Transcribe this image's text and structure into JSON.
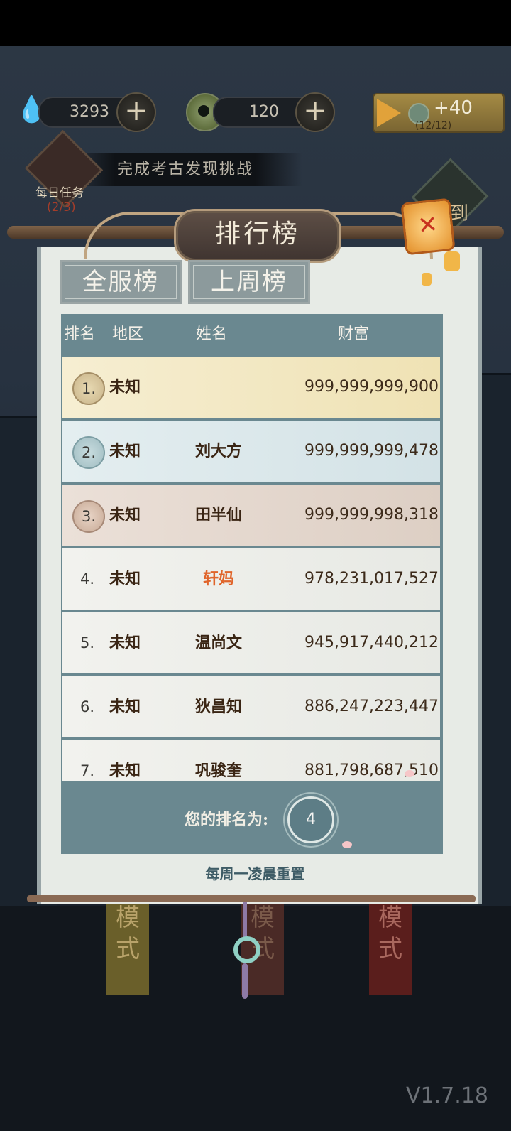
{
  "hud": {
    "currency1": "3293",
    "currency2": "120",
    "ad_reward": "+40",
    "ad_count": "(12/12)"
  },
  "task": {
    "banner": "完成考古发现挑战",
    "label": "每日任务",
    "progress": "(2/3)"
  },
  "checkin_char": "到",
  "leaderboard": {
    "title": "排行榜",
    "tabs": [
      "全服榜",
      "上周榜"
    ],
    "headers": {
      "rank": "排名",
      "region": "地区",
      "name": "姓名",
      "wealth": "财富"
    },
    "rows": [
      {
        "rank": "1.",
        "region": "未知",
        "name": "",
        "wealth": "999,999,999,900"
      },
      {
        "rank": "2.",
        "region": "未知",
        "name": "刘大方",
        "wealth": "999,999,999,478"
      },
      {
        "rank": "3.",
        "region": "未知",
        "name": "田半仙",
        "wealth": "999,999,998,318"
      },
      {
        "rank": "4.",
        "region": "未知",
        "name": "轩妈",
        "wealth": "978,231,017,527"
      },
      {
        "rank": "5.",
        "region": "未知",
        "name": "温尚文",
        "wealth": "945,917,440,212"
      },
      {
        "rank": "6.",
        "region": "未知",
        "name": "狄昌知",
        "wealth": "886,247,223,447"
      },
      {
        "rank": "7.",
        "region": "未知",
        "name": "巩骏奎",
        "wealth": "881,798,687,510"
      }
    ],
    "my_rank_label": "您的排名为:",
    "my_rank": "4",
    "reset_note": "每周一凌晨重置"
  },
  "background_text": [
    "模",
    "式",
    "模",
    "式",
    "模",
    "式"
  ],
  "version": "V1.7.18",
  "colors": {
    "accent_orange": "#e0642a",
    "panel": "#e7ebe6",
    "header": "#6a8890",
    "row1": "#f5ecca",
    "row2": "#dbe7ea",
    "row3": "#e5dad2"
  }
}
